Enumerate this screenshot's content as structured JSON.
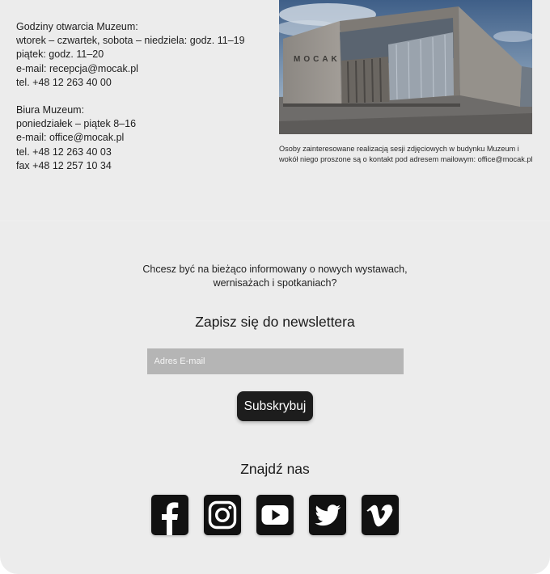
{
  "museum_info": {
    "hours": [
      "Godziny otwarcia Muzeum:",
      "wtorek – czwartek, sobota – niedziela: godz. 11–19",
      "piątek: godz. 11–20",
      "e-mail: recepcja@mocak.pl",
      "tel. +48 12 263 40 00"
    ],
    "offices": [
      "Biura Muzeum:",
      "poniedziałek – piątek 8–16",
      "e-mail: office@mocak.pl",
      "tel. +48 12 263 40 03",
      "fax +48 12 257 10 34"
    ]
  },
  "photo": {
    "building_sign": "MOCAK",
    "caption": "Osoby zainteresowane realizacją sesji zdjęciowych w budynku Muzeum i wokół niego proszone są o kontakt pod adresem mailowym: office@mocak.pl"
  },
  "newsletter": {
    "intro": "Chcesz być na bieżąco informowany o nowych wystawach, wernisażach i spotkaniach?",
    "title": "Zapisz się do newslettera",
    "email_placeholder": "Adres E-mail",
    "email_value": "",
    "subscribe_label": "Subskrybuj"
  },
  "social": {
    "title": "Znajdź nas",
    "icons": [
      "facebook-icon",
      "instagram-icon",
      "youtube-icon",
      "twitter-icon",
      "vimeo-icon"
    ]
  },
  "colors": {
    "page_background": "#ececec",
    "input_background": "#b5b5b5",
    "button_background": "#1d1d1d",
    "icon_background": "#111111"
  }
}
